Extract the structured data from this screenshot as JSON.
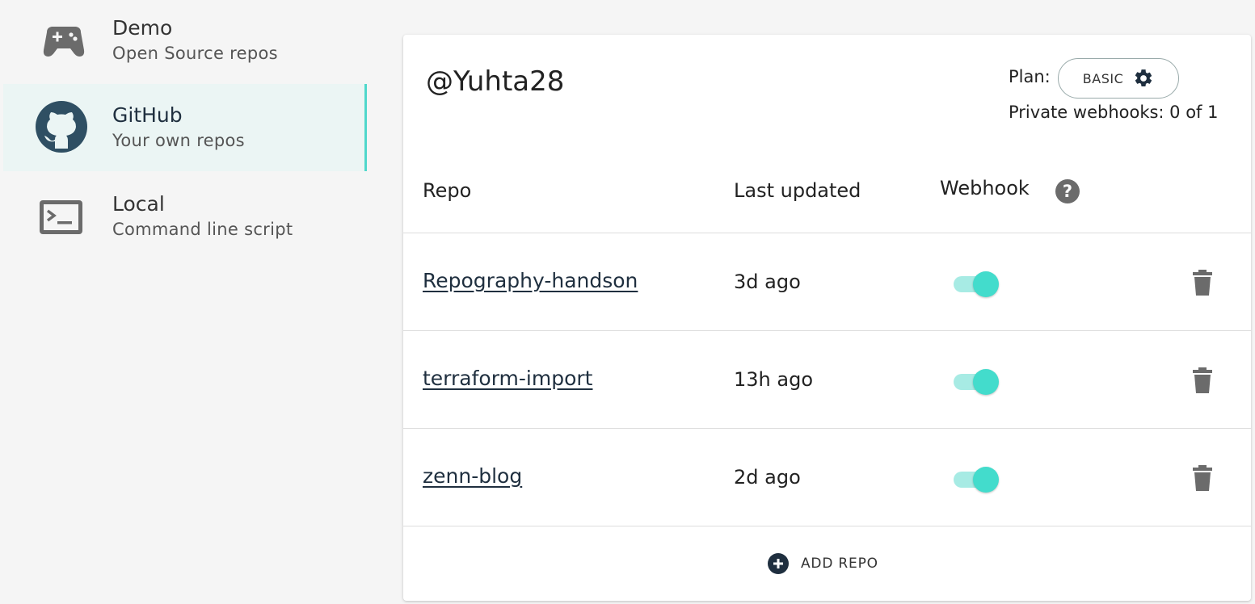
{
  "sidebar": {
    "items": [
      {
        "title": "Demo",
        "subtitle": "Open Source repos",
        "icon": "gamepad-icon"
      },
      {
        "title": "GitHub",
        "subtitle": "Your own repos",
        "icon": "github-icon",
        "active": true
      },
      {
        "title": "Local",
        "subtitle": "Command line script",
        "icon": "terminal-icon"
      }
    ]
  },
  "account": {
    "username": "@Yuhta28",
    "plan_label": "Plan:",
    "plan_value": "BASIC",
    "private_webhooks": "Private webhooks: 0 of 1"
  },
  "table": {
    "headers": {
      "repo": "Repo",
      "updated": "Last updated",
      "webhook": "Webhook"
    },
    "rows": [
      {
        "repo": "Repography-handson",
        "updated": "3d ago",
        "webhook_enabled": true
      },
      {
        "repo": "terraform-import",
        "updated": "13h ago",
        "webhook_enabled": true
      },
      {
        "repo": "zenn-blog",
        "updated": "2d ago",
        "webhook_enabled": true
      }
    ]
  },
  "actions": {
    "add_repo": "ADD REPO"
  },
  "colors": {
    "accent": "#43dccc",
    "accent_light": "#a7ebe4",
    "active_bg": "#ebf5f4",
    "dark": "#1f2f3f",
    "icon_gray": "#6b6b6b"
  }
}
